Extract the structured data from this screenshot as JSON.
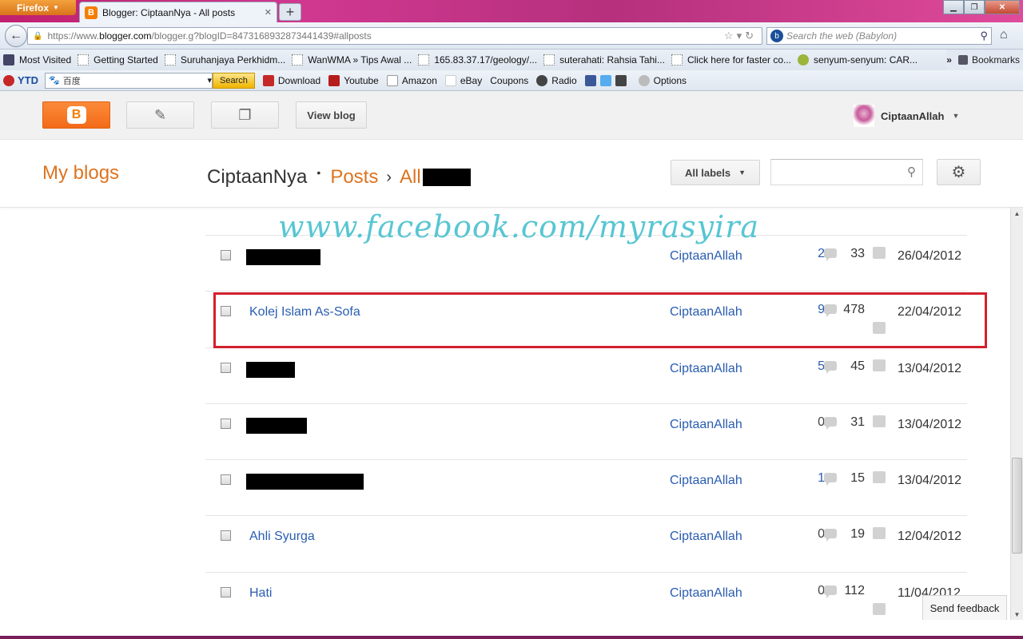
{
  "browser": {
    "app_menu": "Firefox",
    "tab_title": "Blogger: CiptaanNya - All posts",
    "url_host": "https://www.",
    "url_domain": "blogger.com",
    "url_path": "/blogger.g?blogID=8473168932873441439#allposts",
    "search_placeholder": "Search the web (Babylon)"
  },
  "bookmarks": [
    "Most Visited",
    "Getting Started",
    "Suruhanjaya Perkhidm...",
    "WanWMA » Tips Awal ...",
    "165.83.37.17/geology/...",
    "suterahati: Rahsia Tahi...",
    "Click here for faster co...",
    "senyum-senyum: CAR..."
  ],
  "bookmarks_menu": "Bookmarks",
  "toolbar": {
    "brand": "YTD",
    "search_engine_text": "百度",
    "search_button": "Search",
    "items": [
      "Download",
      "Youtube",
      "Amazon",
      "eBay",
      "Coupons",
      "Radio",
      "Options"
    ]
  },
  "blogger": {
    "view_blog": "View blog",
    "username": "CiptaanAllah",
    "my_blogs": "My blogs",
    "blog_name": "CiptaanNya",
    "crumb_posts": "Posts",
    "crumb_all": "All",
    "labels_button": "All labels",
    "watermark": "www.facebook.com/myrasyira",
    "feedback": "Send feedback"
  },
  "posts": [
    {
      "title": "",
      "redacted": true,
      "author": "CiptaanAllah",
      "comments": "2",
      "views": "33",
      "date": "26/04/2012"
    },
    {
      "title": "Kolej Islam As-Sofa",
      "redacted": false,
      "author": "CiptaanAllah",
      "comments": "9",
      "views": "478",
      "date": "22/04/2012"
    },
    {
      "title": "",
      "redacted": true,
      "author": "CiptaanAllah",
      "comments": "5",
      "views": "45",
      "date": "13/04/2012"
    },
    {
      "title": "",
      "redacted": true,
      "author": "CiptaanAllah",
      "comments": "0",
      "views": "31",
      "date": "13/04/2012"
    },
    {
      "title": "",
      "redacted": true,
      "author": "CiptaanAllah",
      "comments": "1",
      "views": "15",
      "date": "13/04/2012"
    },
    {
      "title": "Ahli Syurga",
      "redacted": false,
      "author": "CiptaanAllah",
      "comments": "0",
      "views": "19",
      "date": "12/04/2012"
    },
    {
      "title": "Hati",
      "redacted": false,
      "author": "CiptaanAllah",
      "comments": "0",
      "views": "112",
      "date": "11/04/2012"
    }
  ],
  "colors": {
    "accent": "#dd7420",
    "link": "#2a5db0",
    "highlight": "#d3202e",
    "watermark": "#58c6d3"
  }
}
